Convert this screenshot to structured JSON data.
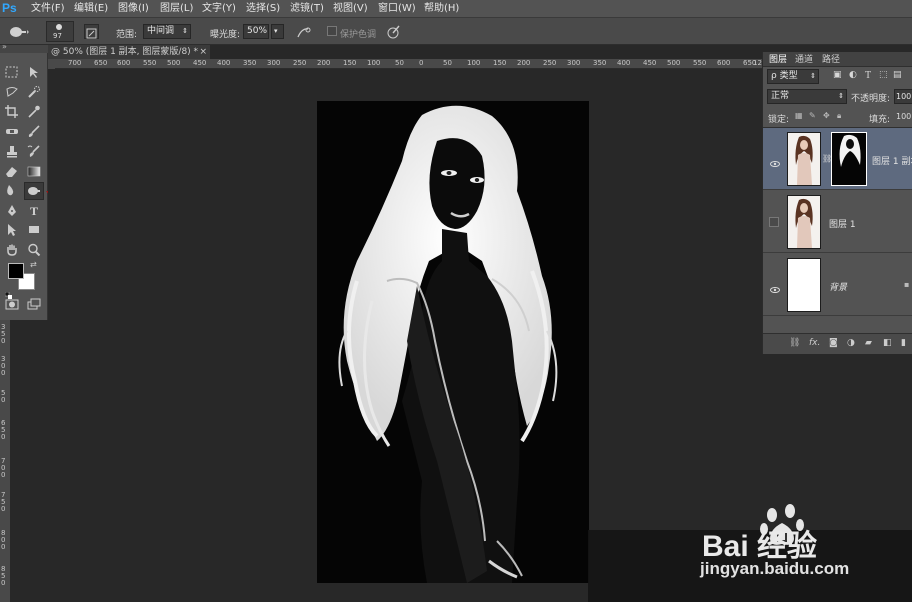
{
  "app": {
    "logo": "Ps"
  },
  "menu": [
    "文件(F)",
    "编辑(E)",
    "图像(I)",
    "图层(L)",
    "文字(Y)",
    "选择(S)",
    "滤镜(T)",
    "视图(V)",
    "窗口(W)",
    "帮助(H)"
  ],
  "options": {
    "brush_size": "97",
    "range_label": "范围:",
    "range_value": "中间调",
    "exposure_label": "曝光度:",
    "exposure_value": "50%",
    "protect_tones_label": "保护色调"
  },
  "document": {
    "tab_title": "@ 50% (图层 1 副本, 图层蒙版/8) *",
    "close": "×"
  },
  "ruler_top": [
    "700",
    "650",
    "600",
    "550",
    "500",
    "450",
    "400",
    "350",
    "300",
    "250",
    "200",
    "150",
    "100",
    "50",
    "0",
    "50",
    "100",
    "150",
    "200",
    "250",
    "300",
    "350",
    "400",
    "450",
    "500",
    "550",
    "600",
    "650",
    "700",
    "750",
    "12"
  ],
  "ruler_left": [
    "3",
    "5",
    "0",
    "3",
    "0",
    "0",
    "5",
    "0",
    "6",
    "5",
    "0",
    "7",
    "0",
    "0",
    "7",
    "5",
    "0",
    "8",
    "0",
    "0",
    "8",
    "5",
    "0",
    "9",
    "0",
    "0",
    "9",
    "5",
    "0",
    "1",
    "0",
    "0",
    "1",
    "0",
    "5",
    "1",
    "1",
    "0"
  ],
  "tools": {
    "colors": {
      "foreground": "#000000",
      "background": "#ffffff"
    },
    "type_glyph": "T"
  },
  "layers_panel": {
    "tabs": [
      "图层",
      "通道",
      "路径"
    ],
    "filter_label": "ρ 类型",
    "blend_mode": "正常",
    "opacity_label": "不透明度:",
    "opacity_value": "100",
    "lock_label": "锁定:",
    "fill_label": "填充:",
    "fill_value": "100",
    "layers": [
      {
        "name": "图层 1 副本",
        "visible": true,
        "selected": true
      },
      {
        "name": "图层 1",
        "visible": false,
        "selected": false
      },
      {
        "name": "背景",
        "visible": true,
        "selected": false
      }
    ],
    "bottom_icons": [
      "link-icon",
      "fx-icon",
      "mask-icon",
      "adjustment-icon",
      "folder-icon",
      "new-layer-icon",
      "trash-icon"
    ],
    "fx_label": "fx."
  },
  "watermark": {
    "brand": "Bai 经验",
    "url": "jingyan.baidu.com"
  },
  "accent_colors": {
    "annotation_arrow": "#b01010",
    "selected_layer": "#5b6f8f",
    "ps_blue": "#31a8ff"
  }
}
